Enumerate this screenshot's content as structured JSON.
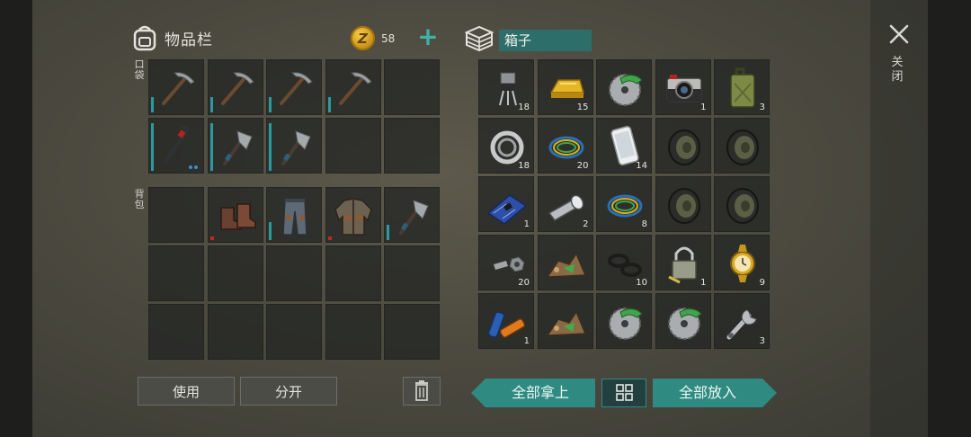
{
  "inventory": {
    "title": "物品栏",
    "coins": "58",
    "pocket_label": "口袋",
    "backpack_label": "背包",
    "pocket_slots": [
      {
        "icon": "pickaxe-icon",
        "dura": 0.3
      },
      {
        "icon": "pickaxe-icon",
        "dura": 0.3
      },
      {
        "icon": "pickaxe-icon",
        "dura": 0.3
      },
      {
        "icon": "pickaxe-icon",
        "dura": 0.3
      },
      {
        "icon": "empty"
      },
      {
        "icon": "crowbar-icon",
        "dura": 0.95,
        "dots": true
      },
      {
        "icon": "hatchet-icon",
        "dura": 0.95
      },
      {
        "icon": "hatchet-icon",
        "dura": 0.95
      },
      {
        "icon": "empty"
      },
      {
        "icon": "empty"
      }
    ],
    "backpack_slots": [
      {
        "icon": "empty"
      },
      {
        "icon": "boots-icon",
        "broken": true
      },
      {
        "icon": "pants-icon",
        "dura": 0.35
      },
      {
        "icon": "jacket-icon",
        "broken": true
      },
      {
        "icon": "hatchet-icon",
        "dura": 0.3
      },
      {
        "icon": "empty"
      },
      {
        "icon": "empty"
      },
      {
        "icon": "empty"
      },
      {
        "icon": "empty"
      },
      {
        "icon": "empty"
      },
      {
        "icon": "empty"
      },
      {
        "icon": "empty"
      },
      {
        "icon": "empty"
      },
      {
        "icon": "empty"
      },
      {
        "icon": "empty"
      }
    ],
    "use_label": "使用",
    "split_label": "分开"
  },
  "box": {
    "title": "箱子",
    "take_all_label": "全部拿上",
    "put_all_label": "全部放入",
    "slots": [
      {
        "icon": "transistor-icon",
        "count": "18"
      },
      {
        "icon": "gold-bar-icon",
        "count": "15"
      },
      {
        "icon": "saw-blade-icon",
        "count": ""
      },
      {
        "icon": "camera-icon",
        "count": "1"
      },
      {
        "icon": "jerrycan-icon",
        "count": "3"
      },
      {
        "icon": "bearing-icon",
        "count": "18"
      },
      {
        "icon": "wires-icon",
        "count": "20"
      },
      {
        "icon": "smartphone-icon",
        "count": "14"
      },
      {
        "icon": "tire-icon",
        "count": ""
      },
      {
        "icon": "tire-icon",
        "count": ""
      },
      {
        "icon": "circuit-board-icon",
        "count": "1"
      },
      {
        "icon": "flashlight-icon",
        "count": "2"
      },
      {
        "icon": "wires-icon",
        "count": "8"
      },
      {
        "icon": "tire-icon",
        "count": ""
      },
      {
        "icon": "tire-icon",
        "count": ""
      },
      {
        "icon": "bolt-nut-icon",
        "count": "20"
      },
      {
        "icon": "ore-pile-icon",
        "count": ""
      },
      {
        "icon": "rubber-rings-icon",
        "count": "10"
      },
      {
        "icon": "padlock-icon",
        "count": "1"
      },
      {
        "icon": "gold-watch-icon",
        "count": "9"
      },
      {
        "icon": "batteries-icon",
        "count": "1"
      },
      {
        "icon": "ore-pile-icon",
        "count": ""
      },
      {
        "icon": "saw-blade-icon",
        "count": ""
      },
      {
        "icon": "saw-blade-icon",
        "count": ""
      },
      {
        "icon": "wrench-icon",
        "count": "3"
      }
    ]
  },
  "close_label": "关闭",
  "colors": {
    "accent": "#2f8a82",
    "durability": "#2b9aa0",
    "broken": "#c0281f"
  }
}
